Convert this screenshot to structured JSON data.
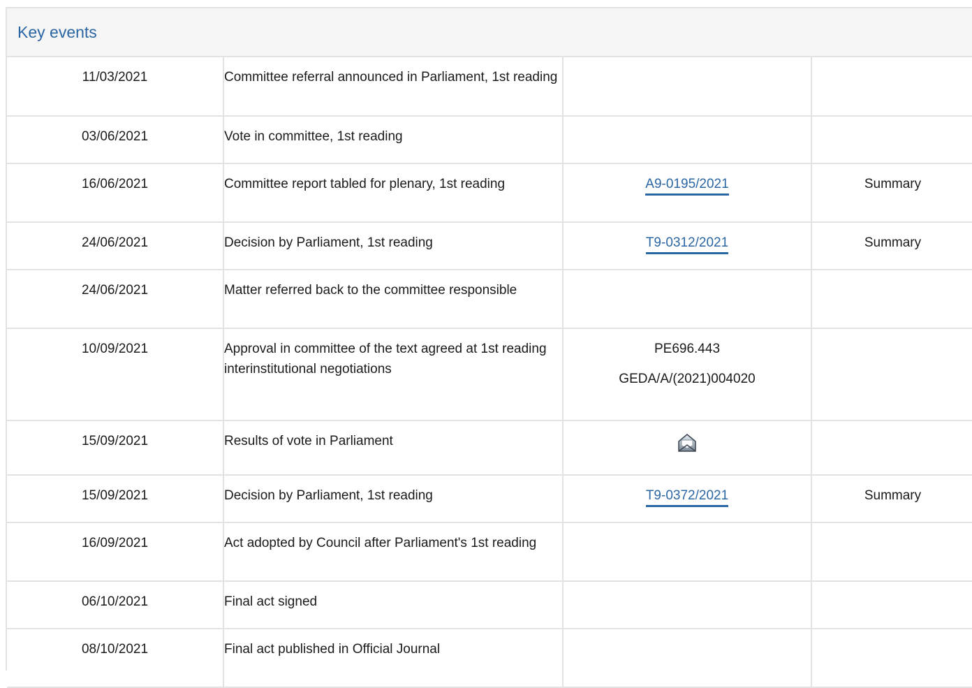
{
  "panel": {
    "title": "Key events"
  },
  "colors": {
    "accent": "#2b66a4",
    "border": "#e2e2e2",
    "header_bg": "#f5f5f5"
  },
  "rows": [
    {
      "date": "11/03/2021",
      "event": "Committee referral announced in Parliament, 1st reading",
      "docs": [],
      "summary": ""
    },
    {
      "date": "03/06/2021",
      "event": "Vote in committee, 1st reading",
      "docs": [],
      "summary": ""
    },
    {
      "date": "16/06/2021",
      "event": "Committee report tabled for plenary, 1st reading",
      "docs": [
        {
          "label": "A9-0195/2021",
          "link": true
        }
      ],
      "summary": "Summary"
    },
    {
      "date": "24/06/2021",
      "event": "Decision by Parliament, 1st reading",
      "docs": [
        {
          "label": "T9-0312/2021",
          "link": true
        }
      ],
      "summary": "Summary"
    },
    {
      "date": "24/06/2021",
      "event": "Matter referred back to the committee responsible",
      "docs": [],
      "summary": ""
    },
    {
      "date": "10/09/2021",
      "event": "Approval in committee of the text agreed at 1st reading interinstitutional negotiations",
      "docs": [
        {
          "label": "PE696.443",
          "link": false
        },
        {
          "label": "GEDA/A/(2021)004020",
          "link": false
        }
      ],
      "summary": ""
    },
    {
      "date": "15/09/2021",
      "event": "Results of vote in Parliament",
      "docs": [],
      "icon": "vote-results-icon",
      "summary": ""
    },
    {
      "date": "15/09/2021",
      "event": "Decision by Parliament, 1st reading",
      "docs": [
        {
          "label": "T9-0372/2021",
          "link": true
        }
      ],
      "summary": "Summary"
    },
    {
      "date": "16/09/2021",
      "event": "Act adopted by Council after Parliament's 1st reading",
      "docs": [],
      "summary": ""
    },
    {
      "date": "06/10/2021",
      "event": "Final act signed",
      "docs": [],
      "summary": ""
    },
    {
      "date": "08/10/2021",
      "event": "Final act published in Official Journal",
      "docs": [],
      "summary": ""
    }
  ]
}
